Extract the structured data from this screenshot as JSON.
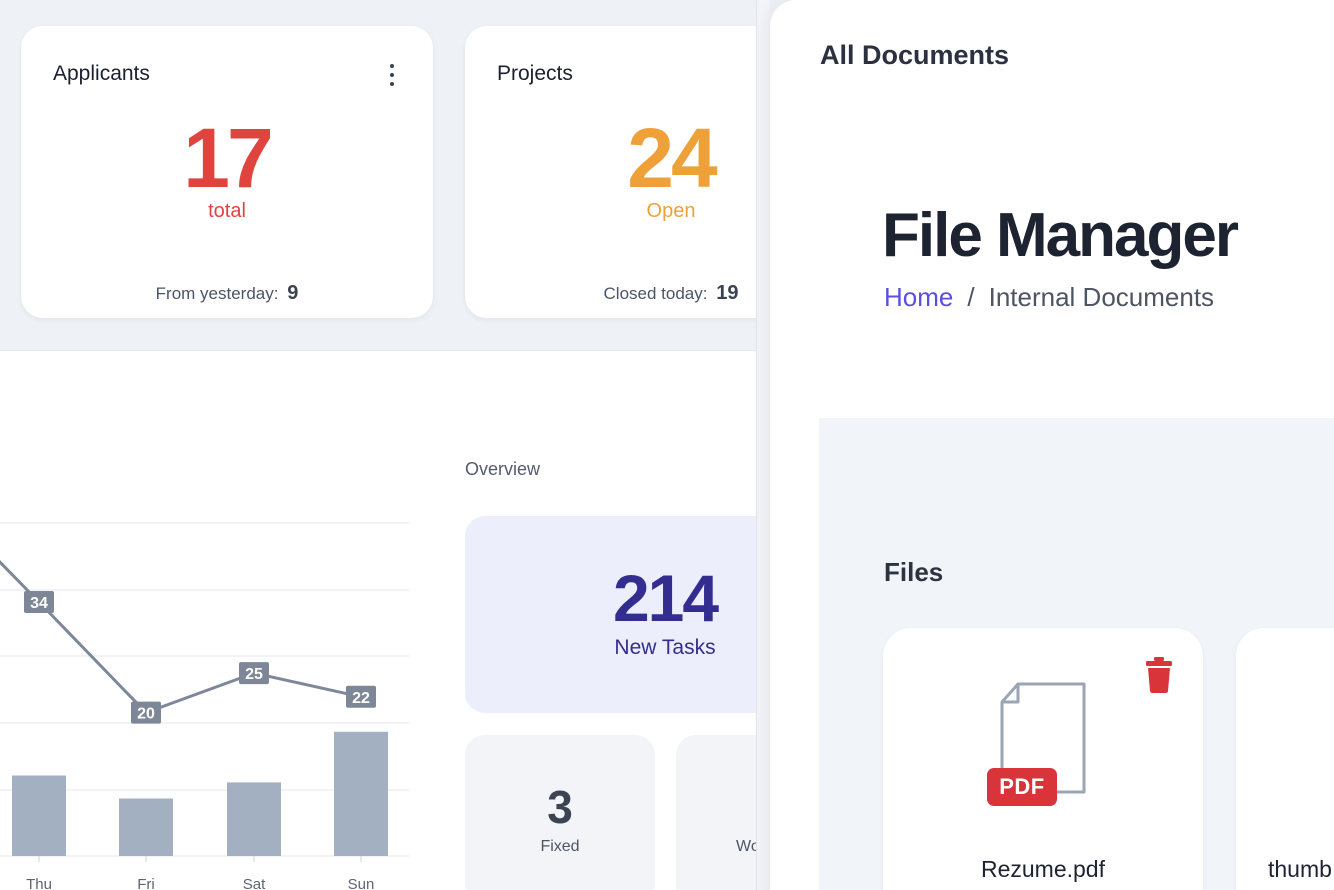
{
  "cards": {
    "applicants": {
      "title": "Applicants",
      "value": "17",
      "sub": "total",
      "footer_label": "From yesterday:",
      "footer_value": "9"
    },
    "projects": {
      "title": "Projects",
      "value": "24",
      "sub": "Open",
      "footer_label": "Closed today:",
      "footer_value": "19"
    }
  },
  "overview": {
    "title": "Overview",
    "tasks_value": "214",
    "tasks_label": "New Tasks",
    "fixed_value": "3",
    "fixed_label": "Fixed",
    "w_label": "Wo"
  },
  "chart_data": {
    "type": "bar",
    "categories": [
      "Thu",
      "Fri",
      "Sat",
      "Sun"
    ],
    "line_series": {
      "values": [
        34,
        20,
        25,
        22
      ]
    },
    "bar_series": {
      "values": [
        17.5,
        12.5,
        16,
        27
      ]
    },
    "colors": {
      "line": "#7d8797",
      "bar": "#a3b0c2",
      "label_bg": "#7d8797"
    }
  },
  "panel": {
    "title": "All Documents",
    "heading": "File Manager",
    "breadcrumb": {
      "home": "Home",
      "separator": "/",
      "current": "Internal Documents"
    },
    "files_label": "Files",
    "files": [
      {
        "name": "Rezume.pdf",
        "badge": "PDF",
        "icon": "pdf-file-icon"
      },
      {
        "name": "thumb",
        "icon": "file-icon"
      }
    ]
  },
  "colors": {
    "applicants_accent": "#e0443f",
    "projects_accent": "#eea039",
    "tasks_accent": "#332d8f",
    "link": "#5b4fe2",
    "delete": "#d9343a"
  }
}
